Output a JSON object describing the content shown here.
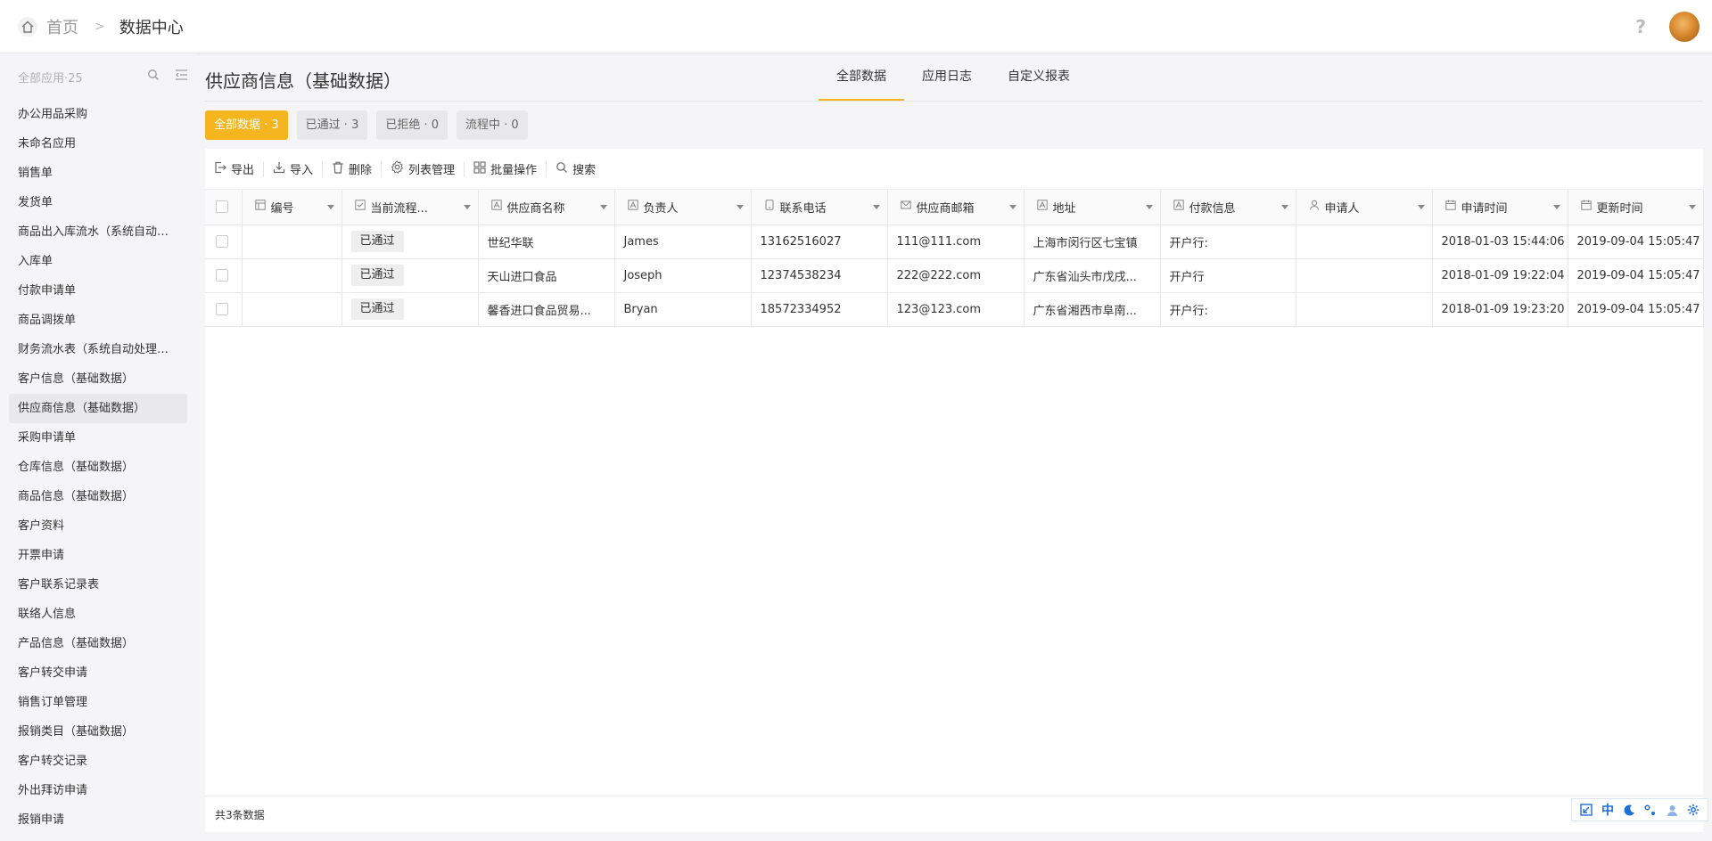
{
  "header": {
    "breadcrumb_home": "首页",
    "breadcrumb_sep": ">",
    "breadcrumb_current": "数据中心",
    "help_icon": "?"
  },
  "sidebar": {
    "title": "全部应用·25",
    "items": [
      {
        "label": "办公用品采购"
      },
      {
        "label": "未命名应用"
      },
      {
        "label": "销售单"
      },
      {
        "label": "发货单"
      },
      {
        "label": "商品出入库流水（系统自动…"
      },
      {
        "label": "入库单"
      },
      {
        "label": "付款申请单"
      },
      {
        "label": "商品调拨单"
      },
      {
        "label": "财务流水表（系统自动处理…"
      },
      {
        "label": "客户信息（基础数据）"
      },
      {
        "label": "供应商信息（基础数据）"
      },
      {
        "label": "采购申请单"
      },
      {
        "label": "仓库信息（基础数据）"
      },
      {
        "label": "商品信息（基础数据）"
      },
      {
        "label": "客户资料"
      },
      {
        "label": "开票申请"
      },
      {
        "label": "客户联系记录表"
      },
      {
        "label": "联络人信息"
      },
      {
        "label": "产品信息（基础数据）"
      },
      {
        "label": "客户转交申请"
      },
      {
        "label": "销售订单管理"
      },
      {
        "label": "报销类目（基础数据）"
      },
      {
        "label": "客户转交记录"
      },
      {
        "label": "外出拜访申请"
      },
      {
        "label": "报销申请"
      }
    ],
    "active_index": 10
  },
  "main": {
    "title": "供应商信息（基础数据）",
    "tabs": [
      {
        "label": "全部数据"
      },
      {
        "label": "应用日志"
      },
      {
        "label": "自定义报表"
      }
    ],
    "filters": [
      {
        "label": "全部数据 · 3"
      },
      {
        "label": "已通过 · 3"
      },
      {
        "label": "已拒绝 · 0"
      },
      {
        "label": "流程中 · 0"
      }
    ],
    "toolbar": [
      {
        "label": "导出",
        "icon": "export-icon"
      },
      {
        "label": "导入",
        "icon": "import-icon"
      },
      {
        "label": "删除",
        "icon": "trash-icon"
      },
      {
        "label": "列表管理",
        "icon": "gear-icon"
      },
      {
        "label": "批量操作",
        "icon": "grid-icon"
      },
      {
        "label": "搜索",
        "icon": "search-icon"
      }
    ],
    "columns": [
      {
        "label": "编号",
        "icon": "id-icon"
      },
      {
        "label": "当前流程...",
        "icon": "check-box-icon"
      },
      {
        "label": "供应商名称",
        "icon": "text-icon"
      },
      {
        "label": "负责人",
        "icon": "text-icon"
      },
      {
        "label": "联系电话",
        "icon": "phone-icon"
      },
      {
        "label": "供应商邮箱",
        "icon": "mail-icon"
      },
      {
        "label": "地址",
        "icon": "text-icon"
      },
      {
        "label": "付款信息",
        "icon": "text-icon"
      },
      {
        "label": "申请人",
        "icon": "user-icon"
      },
      {
        "label": "申请时间",
        "icon": "calendar-icon"
      },
      {
        "label": "更新时间",
        "icon": "calendar-icon"
      }
    ],
    "rows": [
      {
        "id": "",
        "status": "已通过",
        "name": "世纪华联",
        "owner": "James",
        "phone": "13162516027",
        "email": "111@111.com",
        "address": "上海市闵行区七宝镇",
        "payment": "开户行:",
        "applicant": "",
        "apply_time": "2018-01-03 15:44:06",
        "update_time": "2019-09-04 15:05:47"
      },
      {
        "id": "",
        "status": "已通过",
        "name": "天山进口食品",
        "owner": "Joseph",
        "phone": "12374538234",
        "email": "222@222.com",
        "address": "广东省汕头市戊戌...",
        "payment": "开户行",
        "applicant": "",
        "apply_time": "2018-01-09 19:22:04",
        "update_time": "2019-09-04 15:05:47"
      },
      {
        "id": "",
        "status": "已通过",
        "name": "馨香进口食品贸易...",
        "owner": "Bryan",
        "phone": "18572334952",
        "email": "123@123.com",
        "address": "广东省湘西市阜南...",
        "payment": "开户行:",
        "applicant": "",
        "apply_time": "2018-01-09 19:23:20",
        "update_time": "2019-09-04 15:05:47"
      }
    ],
    "footer_text": "共3条数据"
  },
  "bottom_tools": {
    "lang_label": "中"
  },
  "colors": {
    "accent": "#f5b51e",
    "tool_blue": "#1e6fd9"
  }
}
